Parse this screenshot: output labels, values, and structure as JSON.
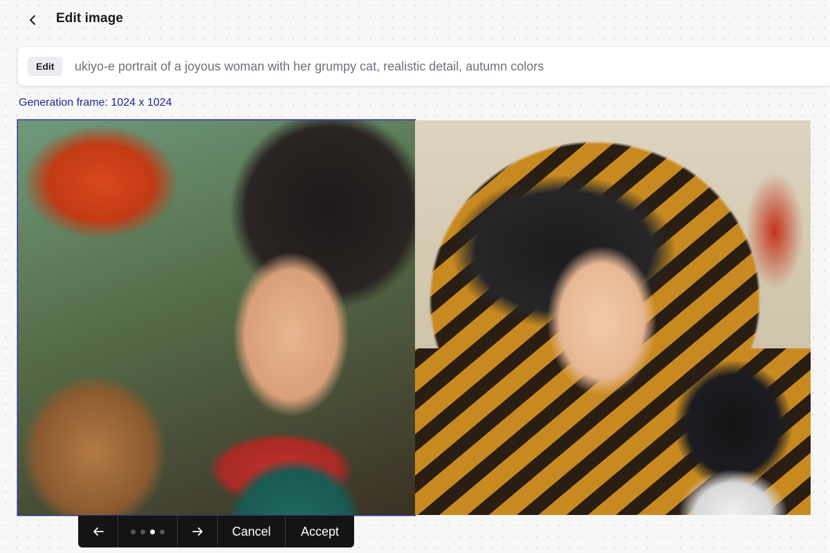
{
  "header": {
    "title": "Edit image",
    "back_icon": "chevron-left-icon"
  },
  "prompt": {
    "badge": "Edit",
    "value": "ukiyo-e portrait of a joyous woman with her grumpy cat, realistic detail, autumn colors"
  },
  "frame_label": "Generation frame: 1024 x 1024",
  "images": [
    {
      "name": "generated-image-selected",
      "selected": true
    },
    {
      "name": "generated-image-adjacent",
      "selected": false
    }
  ],
  "toolbar": {
    "prev_icon": "arrow-left-icon",
    "next_icon": "arrow-right-icon",
    "pagination": {
      "total": 4,
      "active_index": 2
    },
    "cancel_label": "Cancel",
    "accept_label": "Accept"
  },
  "colors": {
    "selection_border": "#2e3396",
    "frame_label": "#1e2a8c",
    "toolbar_bg": "#141414"
  }
}
